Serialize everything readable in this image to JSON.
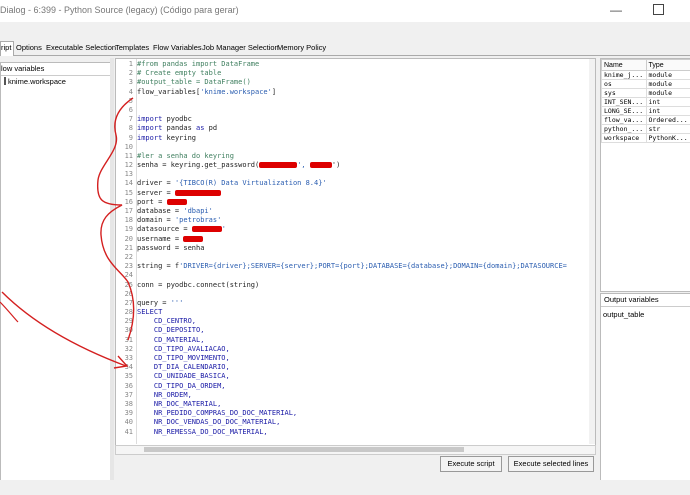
{
  "window": {
    "title": "Dialog - 6:399 - Python Source (legacy) (Código para gerar)"
  },
  "tabs": [
    {
      "label": "Script",
      "shown": "ript",
      "active": true
    },
    {
      "label": "Options",
      "shown": "Options"
    },
    {
      "label": "Executable Selection",
      "shown": "Executable Selection"
    },
    {
      "label": "Templates",
      "shown": "Templates"
    },
    {
      "label": "Flow Variables",
      "shown": "Flow Variables"
    },
    {
      "label": "Job Manager Selection",
      "shown": "Job Manager Selection"
    },
    {
      "label": "Memory Policy",
      "shown": "Memory Policy"
    }
  ],
  "left_panel": {
    "header": "low variables",
    "items": [
      "knime.workspace"
    ]
  },
  "code": {
    "lines": [
      {
        "n": "1",
        "segs": [
          {
            "t": "#from pandas import DataFrame",
            "c": "comment"
          }
        ]
      },
      {
        "n": "2",
        "segs": [
          {
            "t": "# Create empty table",
            "c": "comment"
          }
        ]
      },
      {
        "n": "3",
        "segs": [
          {
            "t": "#output_table = DataFrame()",
            "c": "comment"
          }
        ]
      },
      {
        "n": "4",
        "segs": [
          {
            "t": "flow_variables[",
            "c": ""
          },
          {
            "t": "'knime.workspace'",
            "c": "str"
          },
          {
            "t": "]",
            "c": ""
          }
        ]
      },
      {
        "n": "5",
        "segs": []
      },
      {
        "n": "6",
        "segs": []
      },
      {
        "n": "7",
        "segs": [
          {
            "t": "import",
            "c": "kw"
          },
          {
            "t": " pyodbc",
            "c": ""
          }
        ]
      },
      {
        "n": "8",
        "segs": [
          {
            "t": "import",
            "c": "kw"
          },
          {
            "t": " pandas ",
            "c": ""
          },
          {
            "t": "as",
            "c": "kw"
          },
          {
            "t": " pd",
            "c": ""
          }
        ]
      },
      {
        "n": "9",
        "segs": [
          {
            "t": "import",
            "c": "kw"
          },
          {
            "t": " keyring",
            "c": ""
          }
        ]
      },
      {
        "n": "10",
        "segs": []
      },
      {
        "n": "11",
        "segs": [
          {
            "t": "#ler a senha do keyring",
            "c": "comment"
          }
        ]
      },
      {
        "n": "12",
        "segs": [
          {
            "t": "senha = keyring.get_password(",
            "c": ""
          },
          {
            "t": "",
            "c": "redact",
            "w": 38
          },
          {
            "t": "', ",
            "c": "str"
          },
          {
            "t": "",
            "c": "redact",
            "w": 22
          },
          {
            "t": "')",
            "c": ""
          }
        ]
      },
      {
        "n": "13",
        "segs": []
      },
      {
        "n": "14",
        "segs": [
          {
            "t": "driver = ",
            "c": ""
          },
          {
            "t": "'{TIBCO(R) Data Virtualization 8.4}'",
            "c": "str"
          }
        ]
      },
      {
        "n": "15",
        "segs": [
          {
            "t": "server = ",
            "c": ""
          },
          {
            "t": "",
            "c": "redact",
            "w": 46
          }
        ]
      },
      {
        "n": "16",
        "segs": [
          {
            "t": "port = ",
            "c": ""
          },
          {
            "t": "",
            "c": "redact",
            "w": 20
          }
        ]
      },
      {
        "n": "17",
        "segs": [
          {
            "t": "database = ",
            "c": ""
          },
          {
            "t": "'dbapi'",
            "c": "str"
          }
        ]
      },
      {
        "n": "18",
        "segs": [
          {
            "t": "domain = ",
            "c": ""
          },
          {
            "t": "'petrobras'",
            "c": "str"
          }
        ]
      },
      {
        "n": "19",
        "segs": [
          {
            "t": "datasource = ",
            "c": ""
          },
          {
            "t": "",
            "c": "redact",
            "w": 30
          },
          {
            "t": "'",
            "c": "str"
          }
        ]
      },
      {
        "n": "20",
        "segs": [
          {
            "t": "username = ",
            "c": ""
          },
          {
            "t": "",
            "c": "redact",
            "w": 20
          }
        ]
      },
      {
        "n": "21",
        "segs": [
          {
            "t": "password = senha",
            "c": ""
          }
        ]
      },
      {
        "n": "22",
        "segs": []
      },
      {
        "n": "23",
        "segs": [
          {
            "t": "string = f",
            "c": ""
          },
          {
            "t": "'DRIVER={driver};SERVER={server};PORT={port};DATABASE={database};DOMAIN={domain};DATASOURCE=",
            "c": "str"
          }
        ]
      },
      {
        "n": "24",
        "segs": []
      },
      {
        "n": "25",
        "segs": [
          {
            "t": "conn = pyodbc.connect(string)",
            "c": ""
          }
        ]
      },
      {
        "n": "26",
        "segs": []
      },
      {
        "n": "27",
        "segs": [
          {
            "t": "query = ",
            "c": ""
          },
          {
            "t": "'''",
            "c": "str"
          }
        ]
      },
      {
        "n": "28",
        "segs": [
          {
            "t": "SELECT",
            "c": "kw"
          }
        ]
      },
      {
        "n": "29",
        "segs": [
          {
            "t": "    CD_CENTRO,",
            "c": "kw"
          }
        ]
      },
      {
        "n": "30",
        "segs": [
          {
            "t": "    CD_DEPOSITO,",
            "c": "kw"
          }
        ]
      },
      {
        "n": "31",
        "segs": [
          {
            "t": "    CD_MATERIAL,",
            "c": "kw"
          }
        ]
      },
      {
        "n": "32",
        "segs": [
          {
            "t": "    CD_TIPO_AVALIACAO,",
            "c": "kw"
          }
        ]
      },
      {
        "n": "33",
        "segs": [
          {
            "t": "    CD_TIPO_MOVIMENTO,",
            "c": "kw"
          }
        ]
      },
      {
        "n": "34",
        "segs": [
          {
            "t": "    DT_DIA_CALENDARIO,",
            "c": "kw"
          }
        ]
      },
      {
        "n": "35",
        "segs": [
          {
            "t": "    CD_UNIDADE_BASICA,",
            "c": "kw"
          }
        ]
      },
      {
        "n": "36",
        "segs": [
          {
            "t": "    CD_TIPO_DA_ORDEM,",
            "c": "kw"
          }
        ]
      },
      {
        "n": "37",
        "segs": [
          {
            "t": "    NR_ORDEM,",
            "c": "kw"
          }
        ]
      },
      {
        "n": "38",
        "segs": [
          {
            "t": "    NR_DOC_MATERIAL,",
            "c": "kw"
          }
        ]
      },
      {
        "n": "39",
        "segs": [
          {
            "t": "    NR_PEDIDO_COMPRAS_DO_DOC_MATERIAL,",
            "c": "kw"
          }
        ]
      },
      {
        "n": "40",
        "segs": [
          {
            "t": "    NR_DOC_VENDAS_DO_DOC_MATERIAL,",
            "c": "kw"
          }
        ]
      },
      {
        "n": "41",
        "segs": [
          {
            "t": "    NR_REMESSA_DO_DOC_MATERIAL,",
            "c": "kw"
          }
        ]
      }
    ]
  },
  "buttons": {
    "execute_script": "Execute script",
    "execute_selected": "Execute selected lines"
  },
  "variables_table": {
    "headers": [
      "Name",
      "Type"
    ],
    "rows": [
      [
        "knime_j...",
        "module"
      ],
      [
        "os",
        "module"
      ],
      [
        "sys",
        "module"
      ],
      [
        "INT_SEN...",
        "int"
      ],
      [
        "LONG_SE...",
        "int"
      ],
      [
        "flow_va...",
        "Ordered..."
      ],
      [
        "python_...",
        "str"
      ],
      [
        "workspace",
        "PythonK..."
      ]
    ]
  },
  "output_panel": {
    "header": "Output variables",
    "items": [
      "output_table"
    ]
  },
  "colors": {
    "annotation": "#d42020",
    "comment": "#3f7f5f",
    "keyword": "#1a1aa6",
    "string": "#2a5db0"
  }
}
